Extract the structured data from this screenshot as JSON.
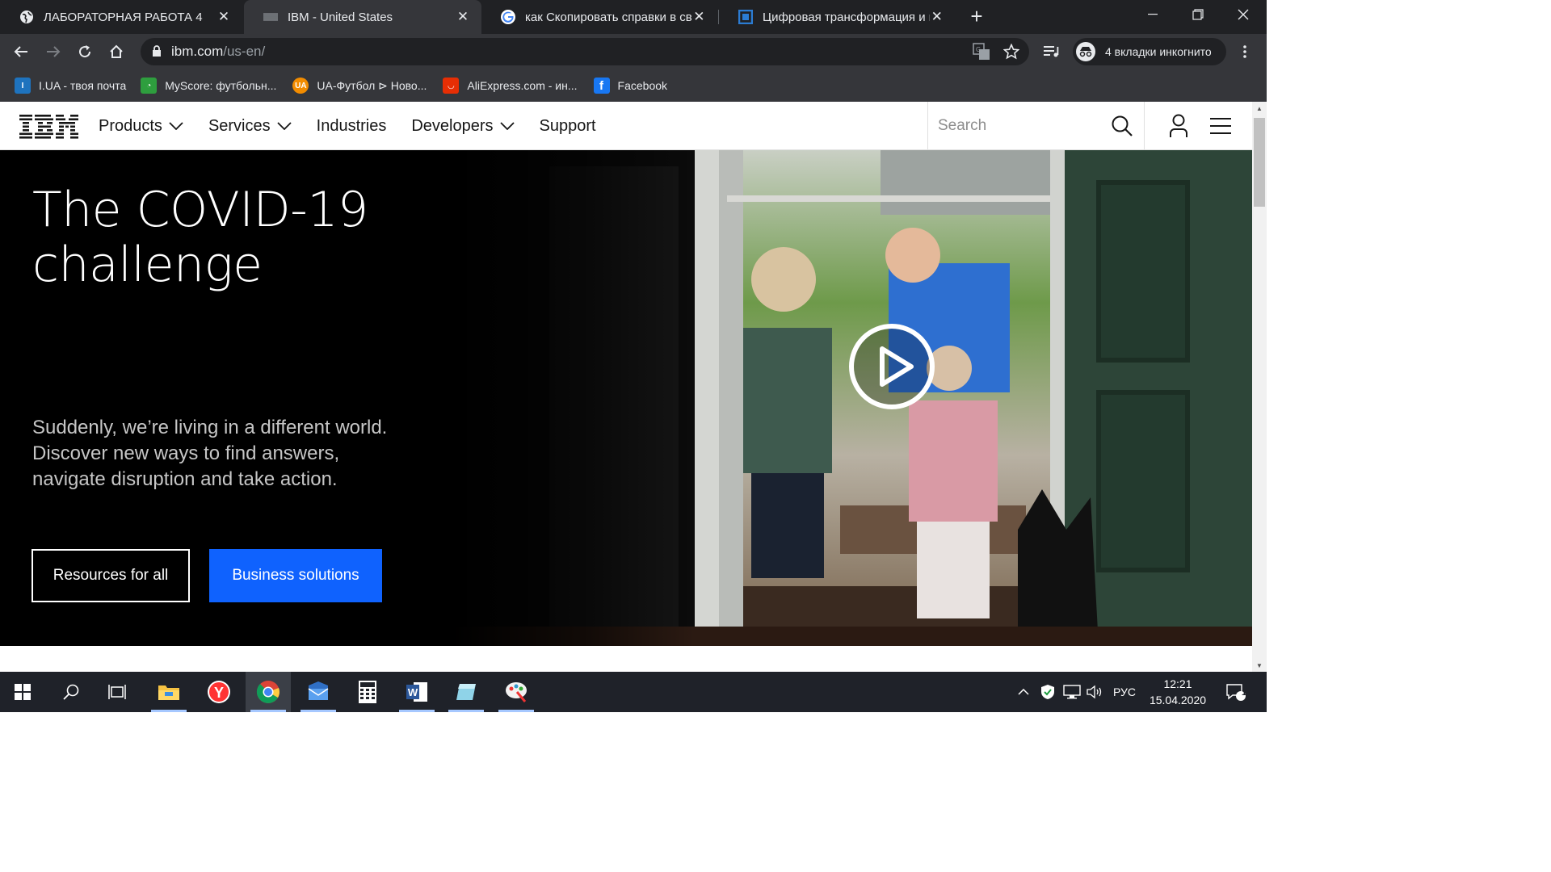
{
  "tabs": [
    {
      "title": "ЛАБОРАТОРНАЯ РАБОТА 4",
      "icon": "globe-icon",
      "active": false
    },
    {
      "title": "IBM - United States",
      "icon": "ibm-favicon",
      "active": true
    },
    {
      "title": "как Скопировать справки в сво",
      "icon": "google-icon",
      "active": false
    },
    {
      "title": "Цифровая трансформация и мо",
      "icon": "doc-icon",
      "active": false
    }
  ],
  "address": {
    "domain": "ibm.com",
    "path": "/us-en/"
  },
  "incognito": {
    "label": "4 вкладки инкогнито"
  },
  "bookmarks": [
    {
      "label": "I.UA - твоя почта",
      "icon": "iua-icon",
      "color": "#1e73be"
    },
    {
      "label": "MyScore: футбольн...",
      "icon": "myscore-icon",
      "color": "#2e9e3e"
    },
    {
      "label": "UA-Футбол ⊳ Ново...",
      "icon": "uafootball-icon",
      "color": "#f28c00"
    },
    {
      "label": "AliExpress.com - ин...",
      "icon": "aliexpress-icon",
      "color": "#e62e04"
    },
    {
      "label": "Facebook",
      "icon": "facebook-icon",
      "color": "#1877f2"
    }
  ],
  "ibm_nav": {
    "menu": [
      {
        "label": "Products",
        "dropdown": true
      },
      {
        "label": "Services",
        "dropdown": true
      },
      {
        "label": "Industries",
        "dropdown": false
      },
      {
        "label": "Developers",
        "dropdown": true
      },
      {
        "label": "Support",
        "dropdown": false
      }
    ],
    "search_placeholder": "Search"
  },
  "hero": {
    "title": "The COVID-19 challenge",
    "description": "Suddenly, we’re living in a different world. Discover new ways to find answers, navigate disruption and take action.",
    "btn_secondary": "Resources for all",
    "btn_primary": "Business solutions",
    "accent": "#0f62fe"
  },
  "taskbar": {
    "apps": [
      "start-icon",
      "search-icon",
      "task-view-icon",
      "file-explorer-icon",
      "yandex-browser-icon",
      "chrome-icon",
      "mail-icon",
      "calculator-icon",
      "word-icon",
      "notes-icon",
      "paint-icon"
    ],
    "tray_lang": "РУС",
    "time": "12:21",
    "date": "15.04.2020",
    "notifications": "1"
  }
}
